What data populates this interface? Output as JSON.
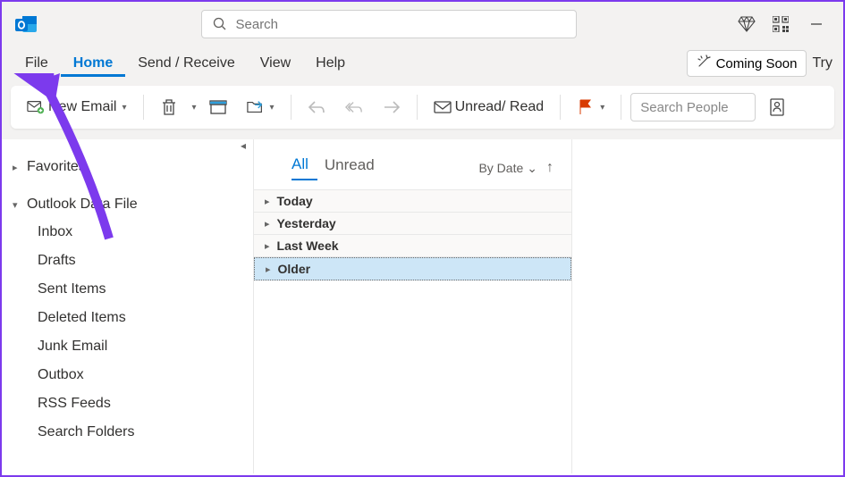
{
  "search": {
    "placeholder": "Search"
  },
  "menu": {
    "file": "File",
    "home": "Home",
    "send_receive": "Send / Receive",
    "view": "View",
    "help": "Help",
    "coming_soon": "Coming Soon",
    "try": "Try"
  },
  "toolbar": {
    "new_email": "New Email",
    "unread_read": "Unread/ Read",
    "search_people": "Search People"
  },
  "sidebar": {
    "favorites": "Favorites",
    "outlook_data_file": "Outlook Data File",
    "folders": [
      "Inbox",
      "Drafts",
      "Sent Items",
      "Deleted Items",
      "Junk Email",
      "Outbox",
      "RSS Feeds",
      "Search Folders"
    ]
  },
  "msglist": {
    "tab_all": "All",
    "tab_unread": "Unread",
    "by_date": "By Date",
    "groups": [
      "Today",
      "Yesterday",
      "Last Week",
      "Older"
    ],
    "selected_group": 3
  }
}
